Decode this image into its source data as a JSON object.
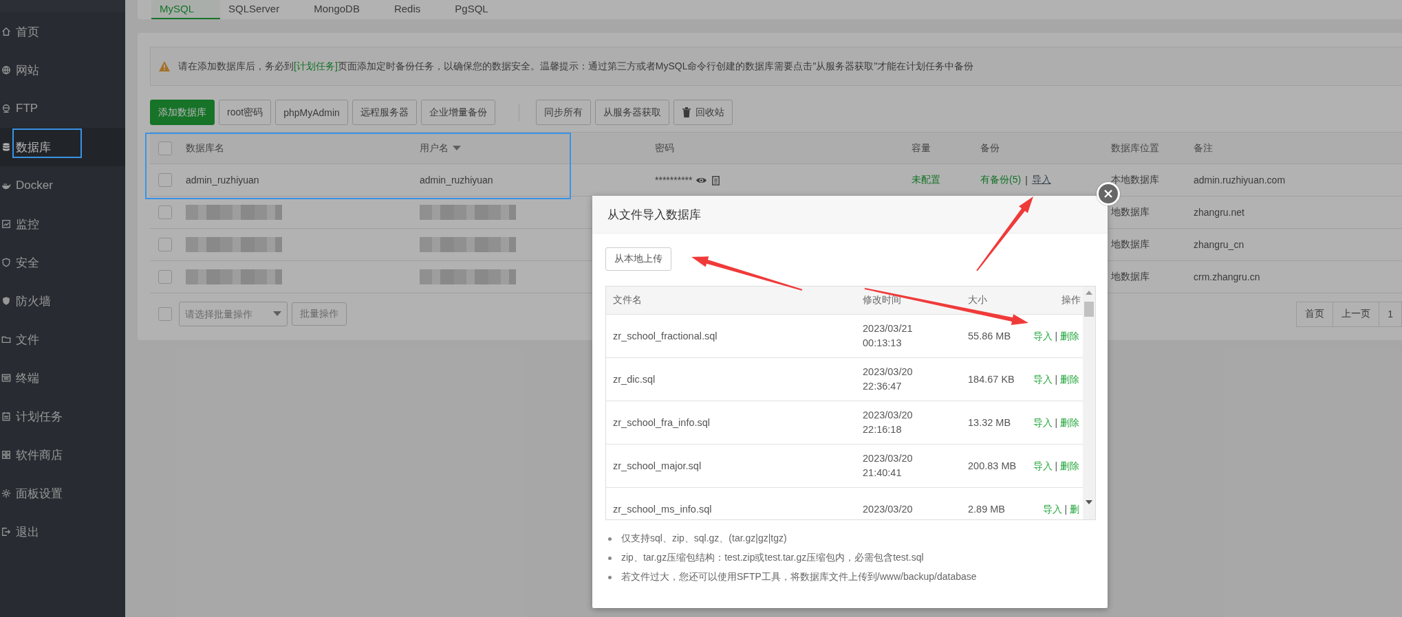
{
  "sidebar": {
    "items": [
      {
        "label": "首页",
        "selected": false
      },
      {
        "label": "网站",
        "selected": false
      },
      {
        "label": "FTP",
        "selected": false
      },
      {
        "label": "数据库",
        "selected": true
      },
      {
        "label": "Docker",
        "selected": false
      },
      {
        "label": "监控",
        "selected": false
      },
      {
        "label": "安全",
        "selected": false
      },
      {
        "label": "防火墙",
        "selected": false
      },
      {
        "label": "文件",
        "selected": false
      },
      {
        "label": "终端",
        "selected": false
      },
      {
        "label": "计划任务",
        "selected": false
      },
      {
        "label": "软件商店",
        "selected": false
      },
      {
        "label": "面板设置",
        "selected": false
      },
      {
        "label": "退出",
        "selected": false
      }
    ]
  },
  "db_tabs": [
    {
      "label": "MySQL",
      "selected": true
    },
    {
      "label": "SQLServer",
      "selected": false
    },
    {
      "label": "MongoDB",
      "selected": false
    },
    {
      "label": "Redis",
      "selected": false
    },
    {
      "label": "PgSQL",
      "selected": false
    }
  ],
  "notice": {
    "parts": [
      {
        "kind": "text",
        "text": "请在添加数据库后，务必到"
      },
      {
        "kind": "link",
        "text": "[计划任务]"
      },
      {
        "kind": "text",
        "text": "页面添加定时备份任务，以确保您的数据安全。温馨提示：通过第三方或者MySQL命令行创建的数据库需要点击\"从服务器获取\"才能在计划任务中备份"
      }
    ]
  },
  "toolbar": {
    "groups": [
      {
        "buttons": [
          {
            "label": "添加数据库",
            "kind": "primary"
          },
          {
            "label": "root密码",
            "kind": "default"
          },
          {
            "label": "phpMyAdmin",
            "kind": "default"
          },
          {
            "label": "远程服务器",
            "kind": "default"
          },
          {
            "label": "企业增量备份",
            "kind": "default"
          }
        ]
      },
      {
        "buttons": [
          {
            "label": "同步所有",
            "kind": "default"
          },
          {
            "label": "从服务器获取",
            "kind": "default"
          },
          {
            "label": "回收站",
            "kind": "trash"
          }
        ]
      }
    ]
  },
  "table": {
    "header_checked": false,
    "columns": [
      {
        "label": "数据库名"
      },
      {
        "label": "用户名",
        "sortable": true
      },
      {
        "label": "密码"
      },
      {
        "label": "容量"
      },
      {
        "label": "备份"
      },
      {
        "label": "数据库位置"
      },
      {
        "label": "备注"
      }
    ],
    "rows": [
      {
        "checked": false,
        "redacted": false,
        "name": "admin_ruzhiyuan",
        "user": "admin_ruzhiyuan",
        "password": "**********",
        "capacity": "未配置",
        "backup": "有备份(5)",
        "separator": "|",
        "import": "导入",
        "location": "本地数据库",
        "note": "admin.ruzhiyuan.com"
      },
      {
        "checked": false,
        "redacted": true,
        "location": "地数据库",
        "note": "zhangru.net"
      },
      {
        "checked": false,
        "redacted": true,
        "location": "地数据库",
        "note": "zhangru_cn"
      },
      {
        "checked": false,
        "redacted": true,
        "location": "地数据库",
        "note": "crm.zhangru.cn"
      }
    ]
  },
  "batch": {
    "checked": false,
    "placeholder": "请选择批量操作",
    "button": "批量操作"
  },
  "pagination": [
    {
      "label": "首页"
    },
    {
      "label": "上一页"
    },
    {
      "label": "1"
    }
  ],
  "modal": {
    "title": "从文件导入数据库",
    "upload_button": "从本地上传",
    "columns": [
      "文件名",
      "修改时间",
      "大小",
      "操作"
    ],
    "files": [
      {
        "name": "zr_school_fractional.sql",
        "date": "2023/03/21",
        "time": "00:13:13",
        "size": "55.86 MB",
        "import": "导入",
        "separator": "|",
        "delete": "删除"
      },
      {
        "name": "zr_dic.sql",
        "date": "2023/03/20",
        "time": "22:36:47",
        "size": "184.67 KB",
        "import": "导入",
        "separator": "|",
        "delete": "删除"
      },
      {
        "name": "zr_school_fra_info.sql",
        "date": "2023/03/20",
        "time": "22:16:18",
        "size": "13.32 MB",
        "import": "导入",
        "separator": "|",
        "delete": "删除"
      },
      {
        "name": "zr_school_major.sql",
        "date": "2023/03/20",
        "time": "21:40:41",
        "size": "200.83 MB",
        "import": "导入",
        "separator": "|",
        "delete": "删除"
      },
      {
        "name": "zr_school_ms_info.sql",
        "date": "2023/03/20",
        "size": "2.89 MB",
        "import": "导入",
        "separator": "|",
        "delete": "删"
      }
    ],
    "notes": [
      "仅支持sql、zip、sql.gz、(tar.gz|gz|tgz)",
      "zip、tar.gz压缩包结构：test.zip或test.tar.gz压缩包内，必需包含test.sql",
      "若文件过大，您还可以使用SFTP工具，将数据库文件上传到/www/backup/database"
    ]
  }
}
